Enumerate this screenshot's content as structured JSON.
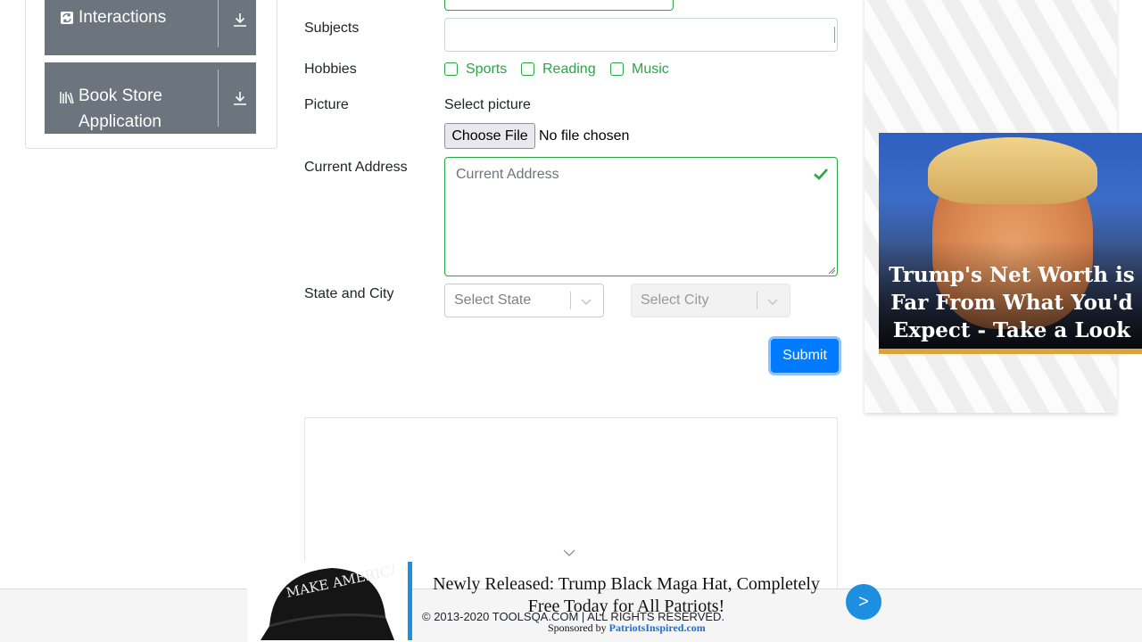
{
  "sidebar": {
    "groups": [
      {
        "label": "Interactions",
        "icon": "interactions-icon"
      },
      {
        "label": "Book Store Application",
        "icon": "book-store-icon"
      }
    ]
  },
  "form": {
    "subjects_label": "Subjects",
    "hobbies_label": "Hobbies",
    "hobbies": [
      "Sports",
      "Reading",
      "Music"
    ],
    "picture_label": "Picture",
    "picture_select_text": "Select picture",
    "choose_file_label": "Choose File",
    "no_file_text": "No file chosen",
    "address_label": "Current Address",
    "address_placeholder": "Current Address",
    "state_city_label": "State and City",
    "state_placeholder": "Select State",
    "city_placeholder": "Select City",
    "submit_label": "Submit"
  },
  "colors": {
    "valid_green": "#28a745",
    "primary_blue": "#007bff",
    "sidebar_gray": "#6c757d"
  },
  "right_ad": {
    "headline": "Trump's Net Worth is Far From What You'd Expect - Take a Look"
  },
  "bottom_ad": {
    "headline": "Newly Released: Trump Black Maga Hat, Completely Free Today for All Patriots!",
    "sponsor_prefix": "Sponsored by",
    "sponsor_name": "PatriotsInspired.com",
    "next_label": ">",
    "hat_text": "MAKE AMERICA GREAT AGAIN"
  },
  "footer": {
    "copyright": "© 2013-2020 TOOLSQA.COM | ALL RIGHTS RESERVED."
  }
}
